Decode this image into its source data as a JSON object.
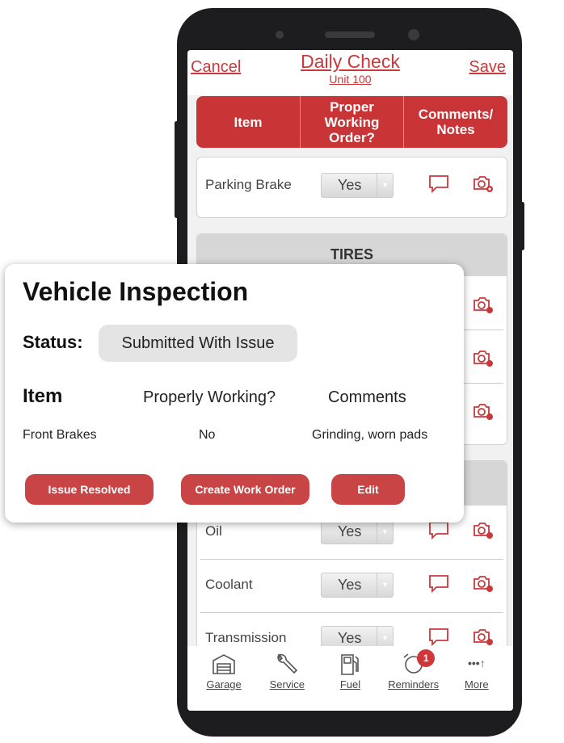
{
  "header": {
    "cancel": "Cancel",
    "title": "Daily Check",
    "subtitle": "Unit 100",
    "save": "Save"
  },
  "table_header": {
    "item": "Item",
    "working": "Proper Working Order?",
    "comments": "Comments/ Notes"
  },
  "sections": [
    {
      "title": "",
      "rows": [
        {
          "label": "Parking Brake",
          "value": "Yes"
        }
      ]
    },
    {
      "title": "TIRES",
      "rows": [
        {
          "label": "",
          "value": ""
        },
        {
          "label": "",
          "value": ""
        },
        {
          "label": "",
          "value": ""
        }
      ]
    },
    {
      "title": "",
      "rows": [
        {
          "label": "Oil",
          "value": "Yes"
        },
        {
          "label": "Coolant",
          "value": "Yes"
        },
        {
          "label": "Transmission",
          "value": "Yes"
        }
      ]
    }
  ],
  "nav": [
    {
      "label": "Garage",
      "icon": "garage-icon"
    },
    {
      "label": "Service",
      "icon": "wrench-icon"
    },
    {
      "label": "Fuel",
      "icon": "fuel-icon"
    },
    {
      "label": "Reminders",
      "icon": "alarm-clock-icon",
      "badge": "1"
    },
    {
      "label": "More",
      "icon": "more-icon"
    }
  ],
  "popup": {
    "title": "Vehicle Inspection",
    "status_label": "Status:",
    "status": "Submitted With Issue",
    "columns": [
      "Item",
      "Properly Working?",
      "Comments"
    ],
    "rows": [
      {
        "item": "Front Brakes",
        "working": "No",
        "comments": "Grinding, worn pads"
      }
    ],
    "buttons": {
      "resolved": "Issue Resolved",
      "work_order": "Create Work Order",
      "edit": "Edit"
    }
  },
  "colors": {
    "accent": "#c93436",
    "section": "#d6d6d6"
  }
}
